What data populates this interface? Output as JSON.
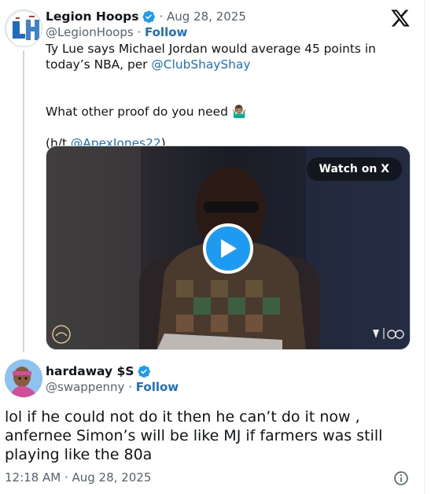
{
  "quoted": {
    "name": "Legion Hoops",
    "date": "· Aug 28, 2025",
    "handle": "@LegionHoops",
    "separator": " · ",
    "follow": "Follow",
    "avatar_letters": "LH",
    "text_line1": "Ty Lue says Michael Jordan would average 45 points in today’s NBA, per ",
    "mention1": "@ClubShayShay",
    "text_line2": "What other proof do you need 🤷🏽‍♂️",
    "text_line3_pre": "(h/t ",
    "mention2": "@ApexJones22",
    "text_line3_post": ")",
    "watch_label": "Watch on X"
  },
  "reply": {
    "name": "hardaway $S",
    "handle": "@swappenny",
    "separator": " · ",
    "follow": "Follow",
    "text": "lol if he could not do it then he can’t do it now , anfernee Simon’s will be like MJ if farmers was still playing like the 80a",
    "timestamp": "12:18 AM · Aug 28, 2025"
  },
  "colors": {
    "accent": "#1d9bf0",
    "link": "#1d70c2",
    "muted": "#536471"
  },
  "icons": [
    "verified-badge-icon",
    "x-logo-icon",
    "play-icon",
    "info-icon"
  ]
}
